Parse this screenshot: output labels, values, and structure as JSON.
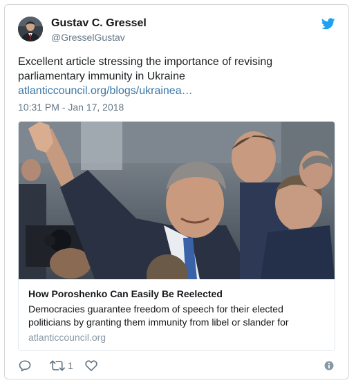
{
  "author": {
    "display_name": "Gustav C. Gressel",
    "handle": "@GresselGustav"
  },
  "tweet": {
    "text": "Excellent article stressing the importance of revising parliamentary immunity in Ukraine",
    "link_text": "atlanticcouncil.org/blogs/ukrainea…",
    "timestamp": "10:31 PM - Jan 17, 2018"
  },
  "link_card": {
    "title": "How Poroshenko Can Easily Be Reelected",
    "description": "Democracies guarantee freedom of speech for their elected politicians by granting them immunity from libel or slander for",
    "domain": "atlanticcouncil.org"
  },
  "actions": {
    "retweet_count": "1"
  },
  "icons": {
    "brand": "twitter-bird-icon",
    "reply": "reply-icon",
    "retweet": "retweet-icon",
    "like": "heart-icon",
    "info": "info-icon"
  },
  "colors": {
    "brand": "#1da1f2",
    "link": "#3b78a8",
    "muted": "#657786"
  }
}
